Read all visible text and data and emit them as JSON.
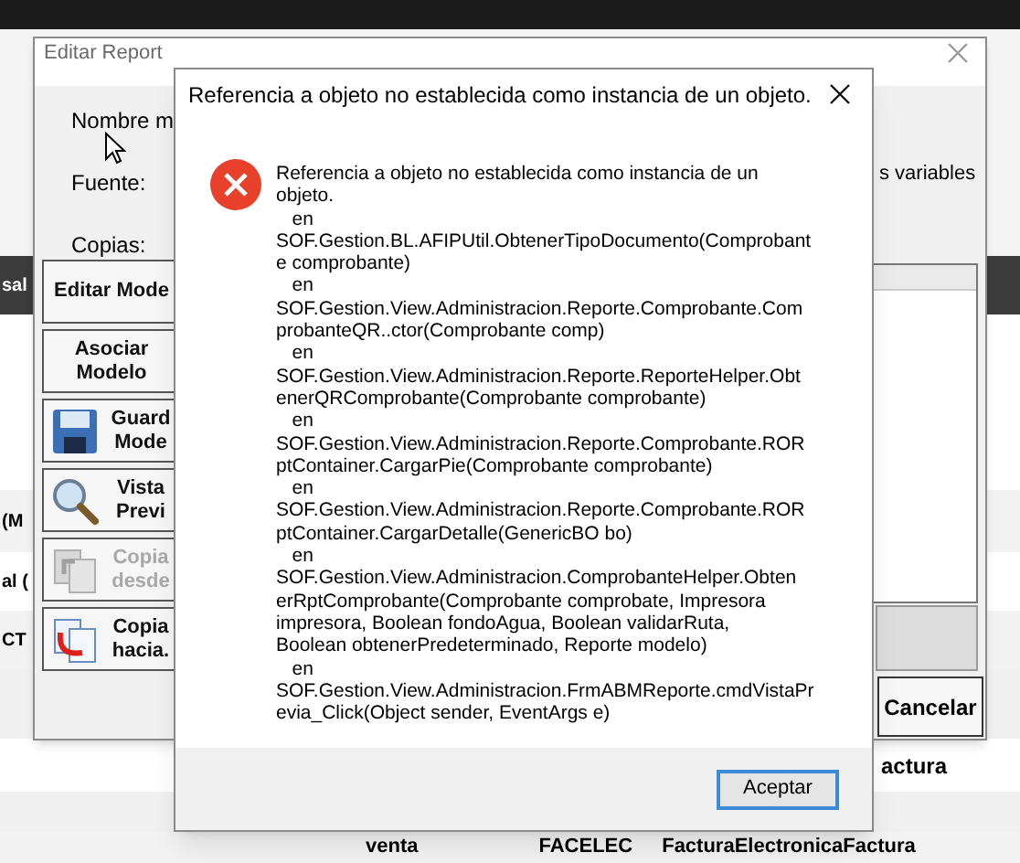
{
  "background": {
    "header_cell": "sal",
    "left_cells": [
      "(M",
      "al (",
      "CT"
    ],
    "bottom_rows": [
      {
        "cells": [
          "actura"
        ]
      },
      {
        "cells": [
          "venta",
          "FACELEC",
          "FacturaElectronicaFactura"
        ]
      }
    ]
  },
  "editor": {
    "title": "Editar Report",
    "labels": [
      "Nombre m",
      "Fuente:",
      "Copias:"
    ],
    "right_label": "s variables",
    "tools": [
      {
        "lines": [
          "Editar Mode"
        ],
        "kind": "text",
        "disabled": false
      },
      {
        "lines": [
          "Asociar",
          "Modelo"
        ],
        "kind": "text",
        "disabled": false
      },
      {
        "lines": [
          "Guard",
          "Mode"
        ],
        "kind": "save",
        "disabled": false
      },
      {
        "lines": [
          "Vista",
          "Previ"
        ],
        "kind": "preview",
        "disabled": false
      },
      {
        "lines": [
          "Copia",
          "desde"
        ],
        "kind": "copy-from",
        "disabled": true
      },
      {
        "lines": [
          "Copia",
          "hacia."
        ],
        "kind": "copy-to",
        "disabled": false
      }
    ],
    "cancel": "Cancelar"
  },
  "dialog": {
    "title": "Referencia a objeto no establecida como instancia de un objeto.",
    "lines": [
      "Referencia a objeto no establecida como instancia de un",
      "objeto.",
      "   en",
      "SOF.Gestion.BL.AFIPUtil.ObtenerTipoDocumento(Comprobant",
      "e comprobante)",
      "   en",
      "SOF.Gestion.View.Administracion.Reporte.Comprobante.Com",
      "probanteQR..ctor(Comprobante comp)",
      "   en",
      "SOF.Gestion.View.Administracion.Reporte.ReporteHelper.Obt",
      "enerQRComprobante(Comprobante comprobante)",
      "   en",
      "SOF.Gestion.View.Administracion.Reporte.Comprobante.ROR",
      "ptContainer.CargarPie(Comprobante comprobante)",
      "   en",
      "SOF.Gestion.View.Administracion.Reporte.Comprobante.ROR",
      "ptContainer.CargarDetalle(GenericBO bo)",
      "   en",
      "SOF.Gestion.View.Administracion.ComprobanteHelper.Obten",
      "erRptComprobante(Comprobante comprobate, Impresora",
      "impresora, Boolean fondoAgua, Boolean validarRuta,",
      "Boolean obtenerPredeterminado, Reporte modelo)",
      "   en",
      "SOF.Gestion.View.Administracion.FrmABMReporte.cmdVistaPr",
      "evia_Click(Object sender, EventArgs e)"
    ],
    "button": "Aceptar"
  }
}
